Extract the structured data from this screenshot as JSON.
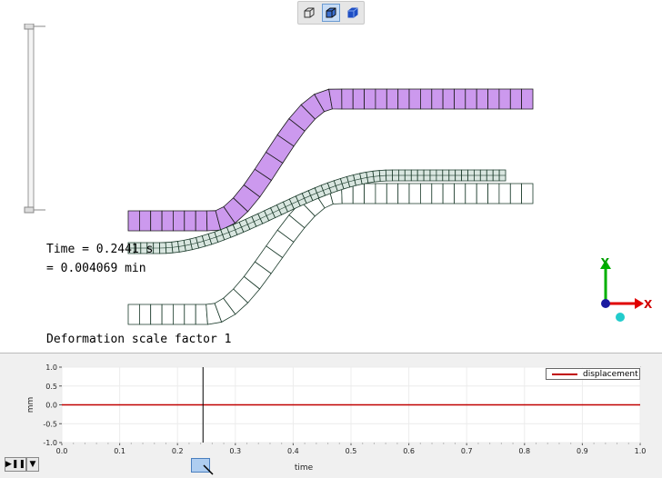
{
  "toolbar": {
    "buttons": [
      {
        "icon": "wireframe-cube-icon"
      },
      {
        "icon": "shaded-edges-cube-icon",
        "active": true
      },
      {
        "icon": "shaded-cube-icon"
      }
    ]
  },
  "viewport": {
    "time_line1": "Time = 0.2441 s",
    "time_line2": "= 0.004069 min",
    "scale_text": "Deformation scale factor 1",
    "axes": {
      "y": "Y",
      "x": "X"
    },
    "colors": {
      "upper": "#cc99ee",
      "middle": "#d9e6e0",
      "lower": "#ffffff",
      "edge_dark": "#1a3a2a"
    }
  },
  "playback": {
    "play_icon": "play-pause-icon",
    "dropdown_icon": "chevron-down-icon"
  },
  "chart_data": {
    "type": "line",
    "xlabel": "time",
    "ylabel": "mm",
    "xlim": [
      0.0,
      1.0
    ],
    "ylim": [
      -1.0,
      1.0
    ],
    "x_ticks": [
      "0.0",
      "0.1",
      "0.2",
      "0.3",
      "0.4",
      "0.5",
      "0.6",
      "0.7",
      "0.8",
      "0.9",
      "1.0"
    ],
    "y_ticks": [
      "1.0",
      "0.5",
      "0.0",
      "-0.5",
      "-1.0"
    ],
    "series": [
      {
        "name": "displacement",
        "color": "#c00000",
        "x": [
          0.0,
          1.0
        ],
        "y": [
          0.0,
          0.0
        ]
      }
    ],
    "cursor_x": 0.2441,
    "grid": true,
    "legend": "top-right"
  }
}
